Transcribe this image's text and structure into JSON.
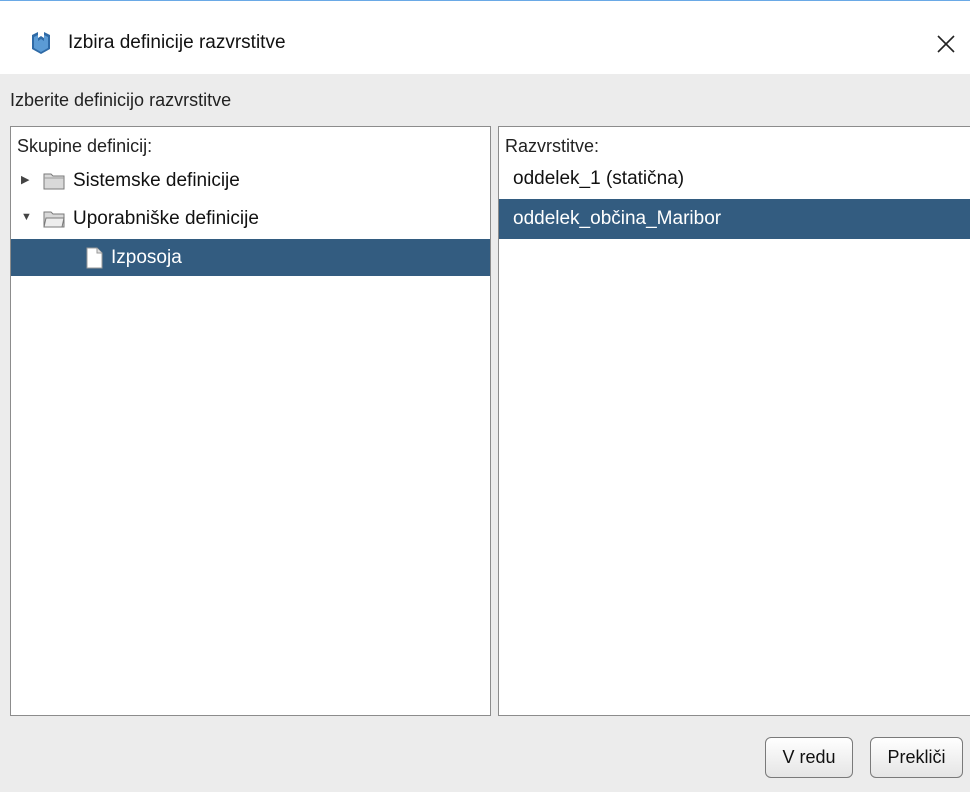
{
  "window": {
    "title": "Izbira definicije razvrstitve",
    "icon": "app-logo-icon",
    "close_icon": "close-icon"
  },
  "instruction": "Izberite definicijo razvrstitve",
  "tree_panel": {
    "label": "Skupine definicij:",
    "nodes": [
      {
        "label": "Sistemske definicije",
        "expanded": false,
        "icon": "folder-icon"
      },
      {
        "label": "Uporabniške definicije",
        "expanded": true,
        "icon": "folder-open-icon"
      },
      {
        "label": "Izposoja",
        "icon": "document-icon",
        "selected": true
      }
    ]
  },
  "list_panel": {
    "label": "Razvrstitve:",
    "items": [
      {
        "label": "oddelek_1 (statična)",
        "selected": false
      },
      {
        "label": "oddelek_občina_Maribor",
        "selected": true
      }
    ]
  },
  "buttons": {
    "ok": "V redu",
    "cancel": "Prekliči"
  },
  "colors": {
    "selection": "#335c80",
    "background": "#ececec"
  }
}
